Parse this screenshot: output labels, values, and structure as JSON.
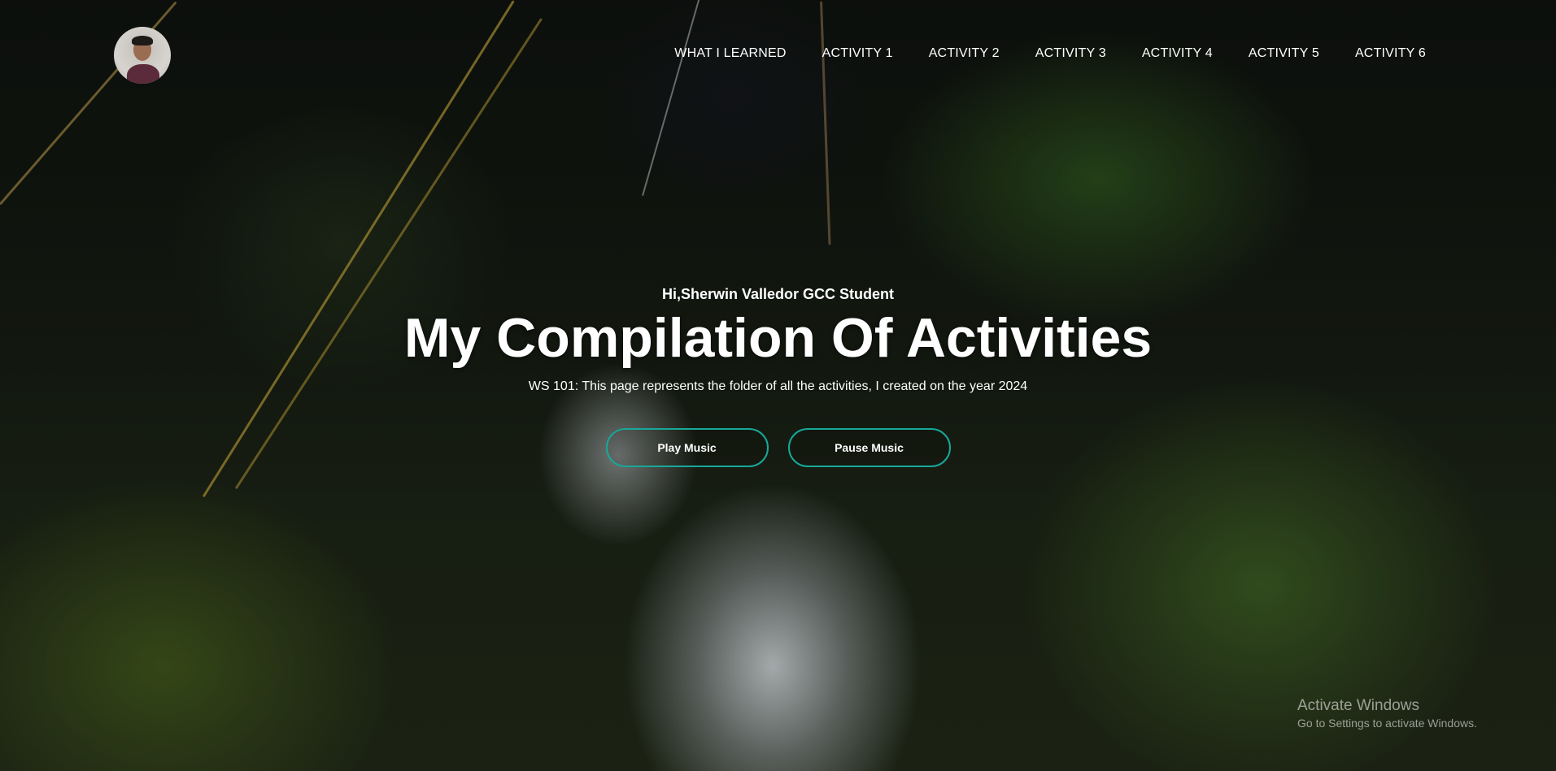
{
  "header": {
    "avatar_icon": "profile-photo",
    "nav": [
      {
        "label": "WHAT I LEARNED"
      },
      {
        "label": "ACTIVITY 1"
      },
      {
        "label": "ACTIVITY 2"
      },
      {
        "label": "ACTIVITY 3"
      },
      {
        "label": "ACTIVITY 4"
      },
      {
        "label": "ACTIVITY 5"
      },
      {
        "label": "ACTIVITY 6"
      }
    ]
  },
  "hero": {
    "greeting": "Hi,Sherwin Valledor GCC Student",
    "title": "My Compilation Of Activities",
    "subtitle": "WS 101: This page represents the folder of all the activities, I created on the year 2024",
    "play_label": "Play Music",
    "pause_label": "Pause Music"
  },
  "watermark": {
    "title": "Activate Windows",
    "subtitle": "Go to Settings to activate Windows."
  },
  "colors": {
    "button_border": "#17a89a",
    "text": "#ffffff"
  }
}
